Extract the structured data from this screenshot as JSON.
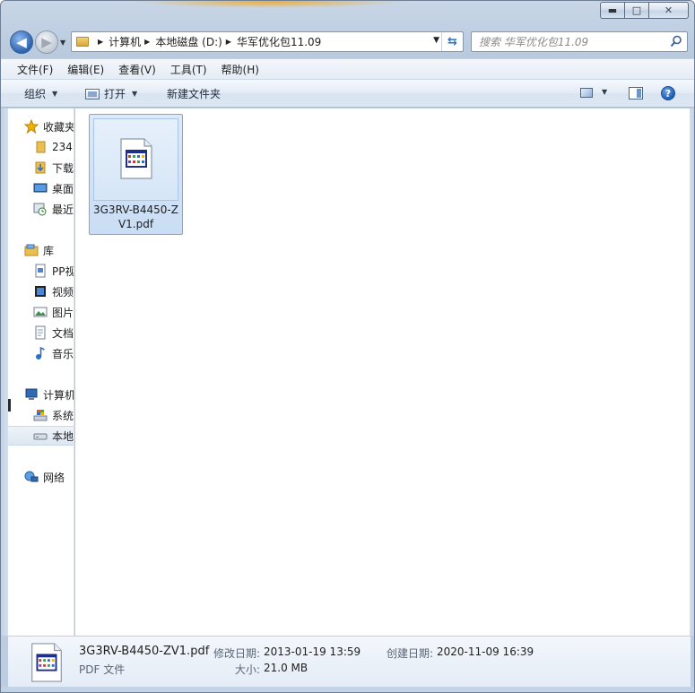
{
  "window": {
    "buttons": {
      "minimize": "▬",
      "maximize": "□",
      "close": "✕"
    }
  },
  "address": {
    "crumbs": [
      "计算机",
      "本地磁盘 (D:)",
      "华军优化包11.09"
    ],
    "search_placeholder": "搜索 华军优化包11.09"
  },
  "menu": [
    "文件(F)",
    "编辑(E)",
    "查看(V)",
    "工具(T)",
    "帮助(H)"
  ],
  "toolbar": {
    "organize": "组织",
    "open": "打开",
    "new_folder": "新建文件夹",
    "help": "?"
  },
  "navpane": {
    "favorites": [
      "收藏夹",
      "234",
      "下载",
      "桌面",
      "最近"
    ],
    "libraries": [
      "库",
      "PP视",
      "视频",
      "图片",
      "文档",
      "音乐"
    ],
    "computer": [
      "计算机",
      "系统",
      "本地"
    ],
    "network": "网络"
  },
  "file": {
    "name": "3G3RV-B4450-ZV1.pdf",
    "name_line1": "3G3RV-B4450-Z",
    "name_line2": "V1.pdf"
  },
  "details": {
    "name": "3G3RV-B4450-ZV1.pdf",
    "type": "PDF 文件",
    "modified_label": "修改日期:",
    "modified_value": "2013-01-19 13:59",
    "created_label": "创建日期:",
    "created_value": "2020-11-09 16:39",
    "size_label": "大小:",
    "size_value": "21.0 MB"
  },
  "colors": {
    "accent": "#2b63b0",
    "selection": "#cce0f6",
    "frame": "#bccde2"
  }
}
